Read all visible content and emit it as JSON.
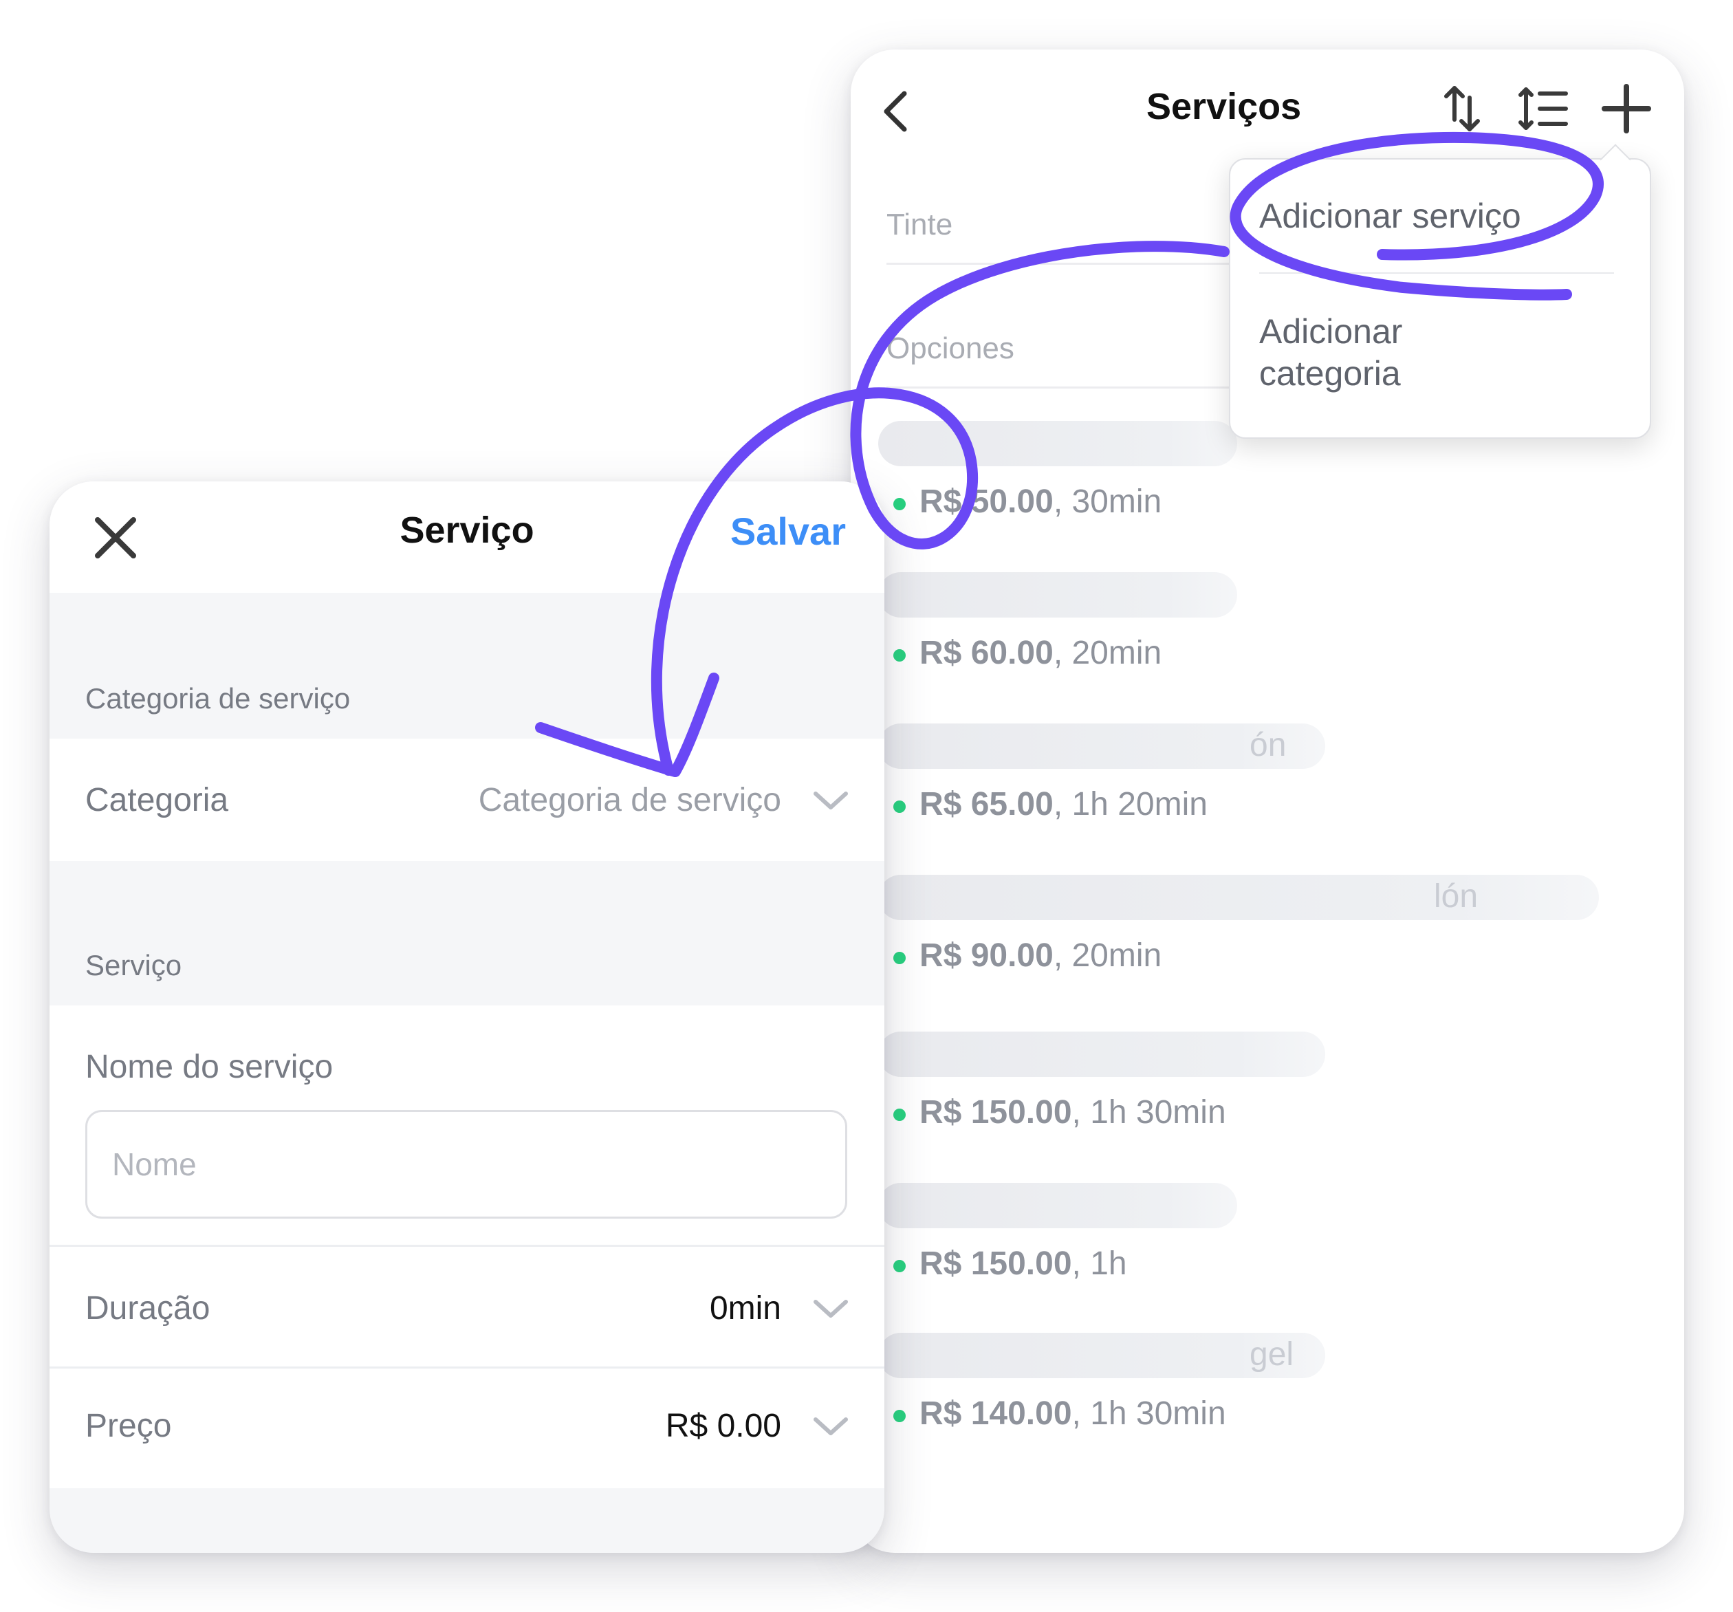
{
  "services_list": {
    "title": "Serviços",
    "categories": [
      {
        "label": "Tinte"
      },
      {
        "label": "Opciones"
      }
    ],
    "menu": {
      "items": [
        {
          "label": "Adicionar serviço"
        },
        {
          "label": "Adicionar\ncategoria"
        }
      ]
    },
    "items": [
      {
        "name_fragment": "",
        "price": "R$ 50.00",
        "duration": ", 30min"
      },
      {
        "name_fragment": "",
        "price": "R$ 60.00",
        "duration": ", 20min"
      },
      {
        "name_fragment": "ón",
        "price": "R$ 65.00",
        "duration": ", 1h 20min"
      },
      {
        "name_fragment": "lón",
        "price": "R$ 90.00",
        "duration": ", 20min"
      },
      {
        "name_fragment": "",
        "price": "R$ 150.00",
        "duration": ", 1h 30min"
      },
      {
        "name_fragment": "",
        "price": "R$ 150.00",
        "duration": ", 1h"
      },
      {
        "name_fragment": "gel",
        "price": "R$ 140.00",
        "duration": ", 1h 30min"
      }
    ],
    "status_color": "#27d17f"
  },
  "service_form": {
    "title": "Serviço",
    "save_label": "Salvar",
    "category_section_label": "Categoria de serviço",
    "category_row": {
      "label": "Categoria",
      "value": "Categoria de serviço"
    },
    "service_section_label": "Serviço",
    "name_label": "Nome do serviço",
    "name_placeholder": "Nome",
    "name_value": "",
    "duration_row": {
      "label": "Duração",
      "value": "0min"
    },
    "price_row": {
      "label": "Preço",
      "value": "R$ 0.00"
    },
    "accent_color": "#3d8ef7"
  },
  "annotation": {
    "highlight_color": "#6a48f5"
  }
}
